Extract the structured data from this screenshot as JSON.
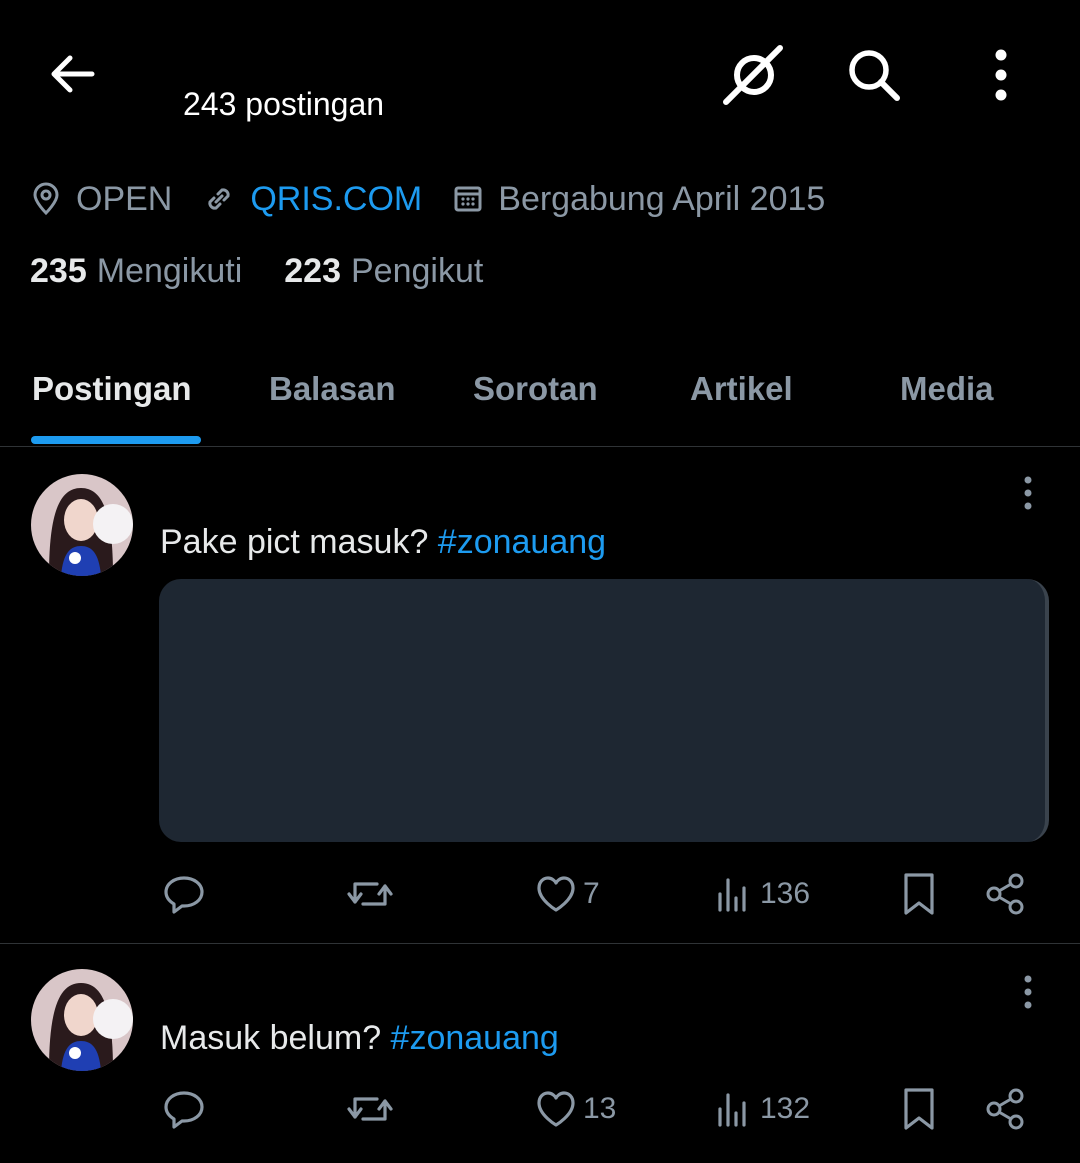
{
  "header": {
    "post_count": "243 postingan",
    "icons": [
      "arrow-left-icon",
      "grok-icon",
      "search-icon",
      "more-vertical-icon"
    ]
  },
  "profile": {
    "location": "OPEN",
    "website": "QRIS.COM",
    "joined": "Bergabung April 2015",
    "following_count": "235",
    "following_label": "Mengikuti",
    "followers_count": "223",
    "followers_label": "Pengikut"
  },
  "tabs": [
    {
      "label": "Postingan",
      "active": true
    },
    {
      "label": "Balasan",
      "active": false
    },
    {
      "label": "Sorotan",
      "active": false
    },
    {
      "label": "Artikel",
      "active": false
    },
    {
      "label": "Media",
      "active": false
    }
  ],
  "posts": [
    {
      "text": "Pake pict masuk? ",
      "hashtag": "#zonauang",
      "has_media": true,
      "likes": "7",
      "views": "136"
    },
    {
      "text": "Masuk belum? ",
      "hashtag": "#zonauang",
      "has_media": false,
      "likes": "13",
      "views": "132"
    }
  ],
  "colors": {
    "background": "#000000",
    "accent": "#1d9bf0",
    "secondary_text": "#8b98a5",
    "media_placeholder": "#1e2732"
  }
}
